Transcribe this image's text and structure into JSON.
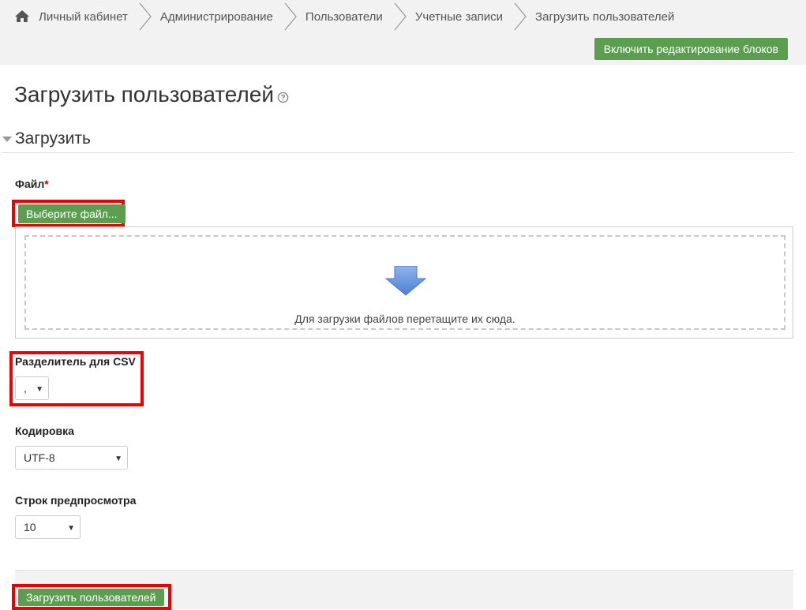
{
  "breadcrumb": {
    "items": [
      "Личный кабинет",
      "Администрирование",
      "Пользователи",
      "Учетные записи",
      "Загрузить пользователей"
    ]
  },
  "header": {
    "edit_button_label": "Включить редактирование блоков"
  },
  "page": {
    "title": "Загрузить пользователей"
  },
  "section": {
    "title": "Загрузить"
  },
  "file_field": {
    "label": "Файл",
    "required_mark": "*",
    "choose_button_label": "Выберите файл...",
    "dropzone_text": "Для загрузки файлов перетащите их сюда."
  },
  "csv_delimiter": {
    "label": "Разделитель для CSV",
    "value": ","
  },
  "encoding": {
    "label": "Кодировка",
    "value": "UTF-8"
  },
  "preview_rows": {
    "label": "Строк предпросмотра",
    "value": "10"
  },
  "submit": {
    "label": "Загрузить пользователей"
  },
  "colors": {
    "accent_green": "#5c9e4f",
    "highlight_red": "#ee0000",
    "header_bg": "#f2f2f2"
  },
  "icons": [
    "home-icon",
    "help-icon",
    "collapse-arrow-icon",
    "download-arrow-icon",
    "chevron-down-icon"
  ]
}
